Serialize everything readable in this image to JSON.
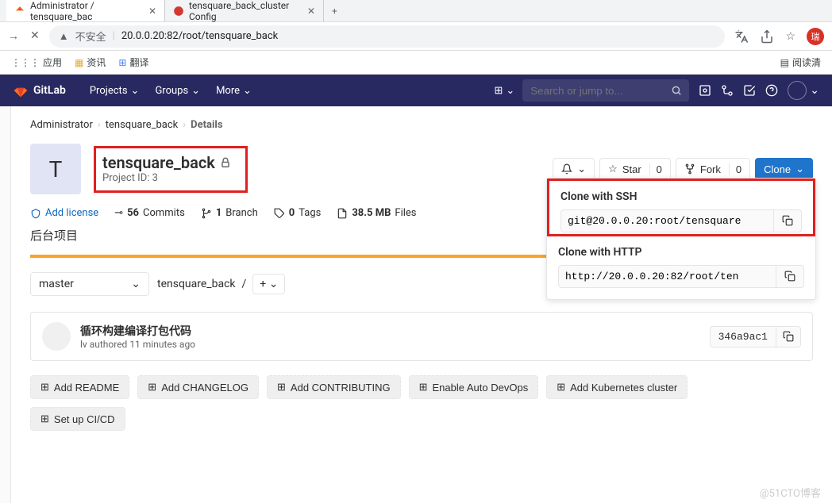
{
  "browser": {
    "tabs": [
      {
        "title": "Administrator / tensquare_bac"
      },
      {
        "title": "tensquare_back_cluster Config"
      }
    ],
    "url_prefix": "不安全",
    "url": "20.0.0.20:82/root/tensquare_back",
    "bookmarks": {
      "apps": "应用",
      "news": "资讯",
      "translate": "翻译",
      "reading": "阅读清"
    },
    "user_initial": "瑞"
  },
  "nav": {
    "brand": "GitLab",
    "projects": "Projects",
    "groups": "Groups",
    "more": "More",
    "search_placeholder": "Search or jump to..."
  },
  "breadcrumb": {
    "owner": "Administrator",
    "project": "tensquare_back",
    "page": "Details"
  },
  "project": {
    "avatar_letter": "T",
    "name": "tensquare_back",
    "id_label": "Project ID: 3",
    "description": "后台项目",
    "actions": {
      "star_label": "Star",
      "star_count": "0",
      "fork_label": "Fork",
      "fork_count": "0",
      "clone_label": "Clone"
    }
  },
  "stats": {
    "add_license": "Add license",
    "commits_count": "56",
    "commits_label": "Commits",
    "branches_count": "1",
    "branches_label": "Branch",
    "tags_count": "0",
    "tags_label": "Tags",
    "storage": "38.5 MB",
    "storage_label": "Files"
  },
  "branch": {
    "current": "master",
    "path": "tensquare_back"
  },
  "commit": {
    "title": "循环构建编译打包代码",
    "author": "lv",
    "authored": "authored",
    "time": "11 minutes ago",
    "sha": "346a9ac1"
  },
  "clone": {
    "ssh_label": "Clone with SSH",
    "ssh_url": "git@20.0.0.20:root/tensquare",
    "http_label": "Clone with HTTP",
    "http_url": "http://20.0.0.20:82/root/ten"
  },
  "suggestions": {
    "readme": "Add README",
    "changelog": "Add CHANGELOG",
    "contributing": "Add CONTRIBUTING",
    "auto_devops": "Enable Auto DevOps",
    "kubernetes": "Add Kubernetes cluster",
    "cicd": "Set up CI/CD"
  },
  "watermark": "@51CTO博客"
}
